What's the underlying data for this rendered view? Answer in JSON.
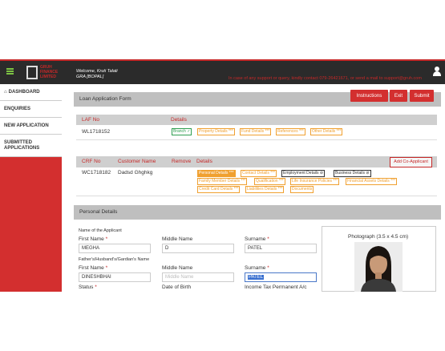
{
  "header": {
    "brand": "GRUH FINANCE LIMITED",
    "welcome_line1": "Welcome, Kruti Talati",
    "welcome_line2": "GRA [BOPAL]",
    "support_text": "In case of any support or query, kindly contact 079-26421671, or send a mail to support@gruh.com"
  },
  "sidebar": {
    "items": [
      {
        "label": "DASHBOARD",
        "icon": "home-icon"
      },
      {
        "label": "ENQUIRIES"
      },
      {
        "label": "NEW APPLICATION"
      },
      {
        "label": "SUBMITTED APPLICATIONS"
      }
    ]
  },
  "loan_form": {
    "title": "Loan Application Form",
    "buttons": {
      "instructions": "Instructions",
      "exit": "Exit",
      "submit": "Submit"
    },
    "laf_table": {
      "headers": [
        "LAF No",
        "Details"
      ],
      "laf_no": "WL1718152",
      "chips": [
        {
          "label": "Branch ✓",
          "style": "green"
        },
        {
          "label": "Property Details ***",
          "style": "orange"
        },
        {
          "label": "Fund Details ***",
          "style": "orange"
        },
        {
          "label": "References ***",
          "style": "orange"
        },
        {
          "label": "Other Details ***",
          "style": "orange"
        }
      ]
    },
    "crf_table": {
      "headers": [
        "CRF No",
        "Customer Name",
        "Remove",
        "Details"
      ],
      "crf_no": "WC1718182",
      "customer_name": "Dadsd Ghghkg",
      "add_co_applicant": "Add Co-Applicant",
      "chips_row1": [
        {
          "label": "Personal Details ***",
          "style": "active"
        },
        {
          "label": "Contact Details ***",
          "style": "orange"
        },
        {
          "label": "Employment Details ⊘",
          "style": "dark"
        },
        {
          "label": "Business Details ⊘",
          "style": "dark"
        }
      ],
      "chips_row2": [
        {
          "label": "Family Member Details ***",
          "style": "orange"
        },
        {
          "label": "Qualification ***",
          "style": "orange"
        },
        {
          "label": "Life Insurance Policies ***",
          "style": "orange"
        },
        {
          "label": "Financial Assets Details ***",
          "style": "orange"
        }
      ],
      "chips_row3": [
        {
          "label": "Credit Card Details ***",
          "style": "orange"
        },
        {
          "label": "Liabilities Details ***",
          "style": "orange"
        },
        {
          "label": "Documents",
          "style": "orange"
        }
      ]
    }
  },
  "personal_details": {
    "title": "Personal Details",
    "name_of_applicant_label": "Name of the Applicant",
    "first_name_label": "First Name",
    "middle_name_label": "Middle Name",
    "surname_label": "Surname",
    "first_name": "MEGHA",
    "middle_name": "D",
    "surname": "PATEL",
    "father_label": "Father's/Husband's/Gardian's Name",
    "father_first_name": "DINESHBHAI",
    "father_middle_placeholder": "Middle Name",
    "father_surname": "PATEL",
    "status_label": "Status",
    "dob_label": "Date of Birth",
    "tax_label": "Income Tax Permanent A/c",
    "photograph_label": "Photograph (3.5 x 4.5 cm)",
    "required_mark": "*"
  },
  "colors": {
    "accent": "#d32f2f",
    "topbar": "#2b2b2b",
    "chip_orange": "#f0a030",
    "chip_green": "#2e9e4f"
  }
}
